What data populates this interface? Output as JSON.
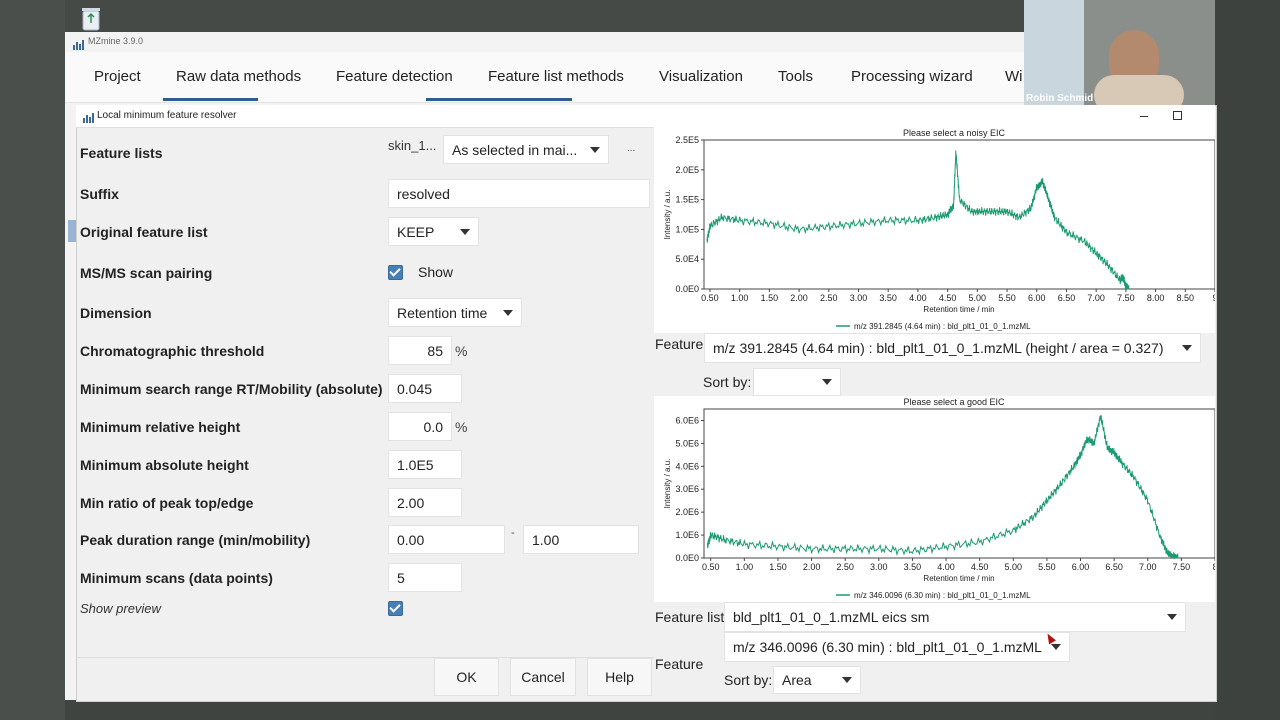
{
  "app": {
    "title": "MZmine 3.9.0"
  },
  "menu": [
    "Project",
    "Raw data methods",
    "Feature detection",
    "Feature list methods",
    "Visualization",
    "Tools",
    "Processing wizard",
    "Wi"
  ],
  "webcam": {
    "name": "Robin Schmid"
  },
  "dialog": {
    "title": "Local minimum feature resolver",
    "params": {
      "feature_lists": {
        "label": "Feature lists",
        "value": "skin_1...",
        "option": "As selected in mai...",
        "more": "..."
      },
      "suffix": {
        "label": "Suffix",
        "value": "resolved"
      },
      "original": {
        "label": "Original feature list",
        "value": "KEEP"
      },
      "msms": {
        "label": "MS/MS scan pairing",
        "check_label": "Show"
      },
      "dimension": {
        "label": "Dimension",
        "value": "Retention time"
      },
      "chrom": {
        "label": "Chromatographic threshold",
        "value": "85",
        "unit": "%"
      },
      "minsearch": {
        "label": "Minimum search range RT/Mobility (absolute)",
        "value": "0.045"
      },
      "minrel": {
        "label": "Minimum relative height",
        "value": "0.0",
        "unit": "%"
      },
      "minabs": {
        "label": "Minimum absolute height",
        "value": "1.0E5"
      },
      "ratio": {
        "label": "Min ratio of peak top/edge",
        "value": "2.00"
      },
      "duration": {
        "label": "Peak duration range (min/mobility)",
        "min": "0.00",
        "sep": "-",
        "max": "1.00"
      },
      "minscans": {
        "label": "Minimum scans (data points)",
        "value": "5"
      },
      "preview": {
        "label": "Show preview"
      }
    },
    "buttons": {
      "ok": "OK",
      "cancel": "Cancel",
      "help": "Help"
    }
  },
  "preview": {
    "noisy": {
      "feature_label": "Feature",
      "feature_value": "m/z 391.2845 (4.64 min) : bld_plt1_01_0_1.mzML (height / area = 0.327)",
      "sort_label": "Sort by:",
      "sort_value": ""
    },
    "good": {
      "feature_list_label": "Feature list",
      "feature_list_value": "bld_plt1_01_0_1.mzML eics sm",
      "feature_label": "Feature",
      "feature_value": "m/z 346.0096 (6.30 min) : bld_plt1_01_0_1.mzML",
      "sort_label": "Sort by:",
      "sort_value": "Area"
    }
  },
  "chart_data": [
    {
      "type": "line",
      "title": "Please select a noisy EIC",
      "xlabel": "Retention time / min",
      "ylabel": "Intensity / a.u.",
      "xticks": [
        "0.50",
        "1.00",
        "1.50",
        "2.00",
        "2.50",
        "3.00",
        "3.50",
        "4.00",
        "4.50",
        "5.00",
        "5.50",
        "6.00",
        "6.50",
        "7.00",
        "7.50",
        "8.00",
        "8.50",
        "9"
      ],
      "yticks": [
        "0.0E0",
        "5.0E4",
        "1.0E5",
        "1.5E5",
        "2.0E5",
        "2.5E5"
      ],
      "xlim": [
        0.4,
        9.0
      ],
      "ylim": [
        0,
        250000
      ],
      "color": "#1a9b6e",
      "series": [
        {
          "name": "m/z 391.2845 (4.64 min) : bld_plt1_01_0_1.mzML",
          "x": [
            0.45,
            0.5,
            0.7,
            1.0,
            1.5,
            2.0,
            2.5,
            3.0,
            3.5,
            4.0,
            4.3,
            4.5,
            4.6,
            4.64,
            4.7,
            4.9,
            5.1,
            5.3,
            5.5,
            5.7,
            5.9,
            6.0,
            6.1,
            6.2,
            6.3,
            6.5,
            6.8,
            7.0,
            7.2,
            7.4,
            7.45,
            7.5,
            7.55
          ],
          "y": [
            80000,
            105000,
            120000,
            115000,
            110000,
            100000,
            105000,
            110000,
            115000,
            115000,
            120000,
            125000,
            140000,
            230000,
            150000,
            130000,
            130000,
            130000,
            130000,
            120000,
            135000,
            170000,
            180000,
            150000,
            120000,
            95000,
            80000,
            60000,
            40000,
            15000,
            20000,
            5000,
            0
          ]
        }
      ]
    },
    {
      "type": "line",
      "title": "Please select a good EIC",
      "xlabel": "Retention time / min",
      "ylabel": "Intensity / a.u.",
      "xticks": [
        "0.50",
        "1.00",
        "1.50",
        "2.00",
        "2.50",
        "3.00",
        "3.50",
        "4.00",
        "4.50",
        "5.00",
        "5.50",
        "6.00",
        "6.50",
        "7.00",
        "7.50",
        "8"
      ],
      "yticks": [
        "0.0E0",
        "1.0E6",
        "2.0E6",
        "3.0E6",
        "4.0E6",
        "5.0E6",
        "6.0E6"
      ],
      "xlim": [
        0.4,
        8.0
      ],
      "ylim": [
        0,
        6500000
      ],
      "color": "#1a9b6e",
      "series": [
        {
          "name": "m/z 346.0096 (6.30 min) : bld_plt1_01_0_1.mzML",
          "x": [
            0.45,
            0.5,
            0.7,
            1.0,
            1.5,
            2.0,
            2.5,
            3.0,
            3.5,
            4.0,
            4.5,
            5.0,
            5.3,
            5.5,
            5.7,
            5.9,
            6.0,
            6.1,
            6.2,
            6.3,
            6.4,
            6.5,
            6.6,
            6.8,
            7.0,
            7.2,
            7.3,
            7.4,
            7.45
          ],
          "y": [
            500000,
            1000000,
            800000,
            600000,
            500000,
            400000,
            400000,
            400000,
            300000,
            500000,
            700000,
            1200000,
            1800000,
            2500000,
            3200000,
            4000000,
            4500000,
            5200000,
            5000000,
            6200000,
            4800000,
            4600000,
            4200000,
            3500000,
            2500000,
            800000,
            200000,
            50000,
            0
          ]
        }
      ]
    }
  ]
}
